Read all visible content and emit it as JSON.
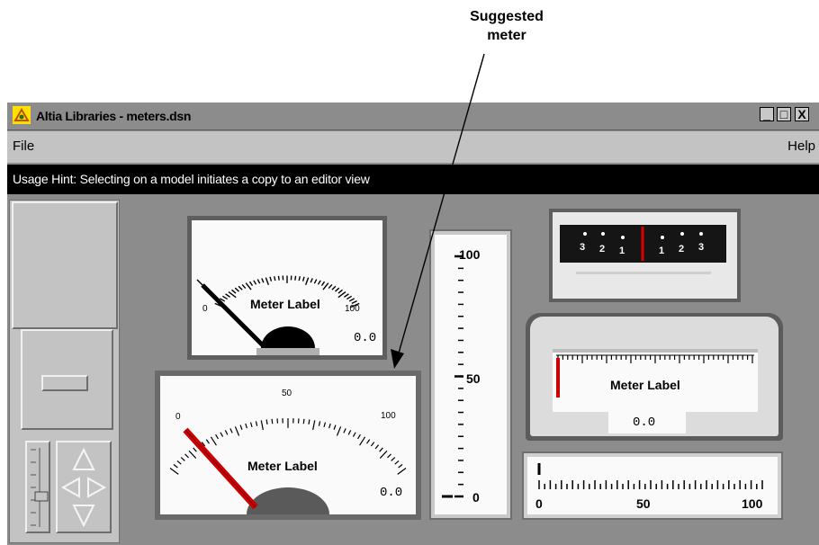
{
  "callout": {
    "line1": "Suggested",
    "line2": "meter"
  },
  "window": {
    "title": "Altia Libraries - meters.dsn",
    "controls": {
      "minimize": "_",
      "maximize": "□",
      "close": "X"
    }
  },
  "menu": {
    "file": "File",
    "help": "Help"
  },
  "hint": "Usage Hint:  Selecting on a model initiates a copy to an editor view",
  "meters": {
    "top_dial": {
      "label": "Meter Label",
      "min": "0",
      "max": "100",
      "value": "0.0"
    },
    "suggested_dial": {
      "label": "Meter Label",
      "min": "0",
      "mid": "50",
      "max": "100",
      "value": "0.0"
    },
    "vertical_scale": {
      "top": "100",
      "mid": "50",
      "bottom": "0"
    },
    "center_zero": {
      "ticks": [
        "3",
        "2",
        "1",
        "1",
        "2",
        "3"
      ]
    },
    "edge_meter": {
      "label": "Meter Label",
      "value": "0.0"
    },
    "horizontal_scale": {
      "min": "0",
      "mid": "50",
      "max": "100"
    }
  },
  "colors": {
    "window_bg": "#8c8c8c",
    "menubar_bg": "#c3c3c3",
    "hint_bg": "#000000",
    "needle": "#cc0000",
    "panel_bg": "#c3c3c3"
  },
  "icons": {
    "app": "altia-app-icon",
    "up": "arrow-up-icon",
    "down": "arrow-down-icon",
    "left": "arrow-left-icon",
    "right": "arrow-right-icon"
  }
}
